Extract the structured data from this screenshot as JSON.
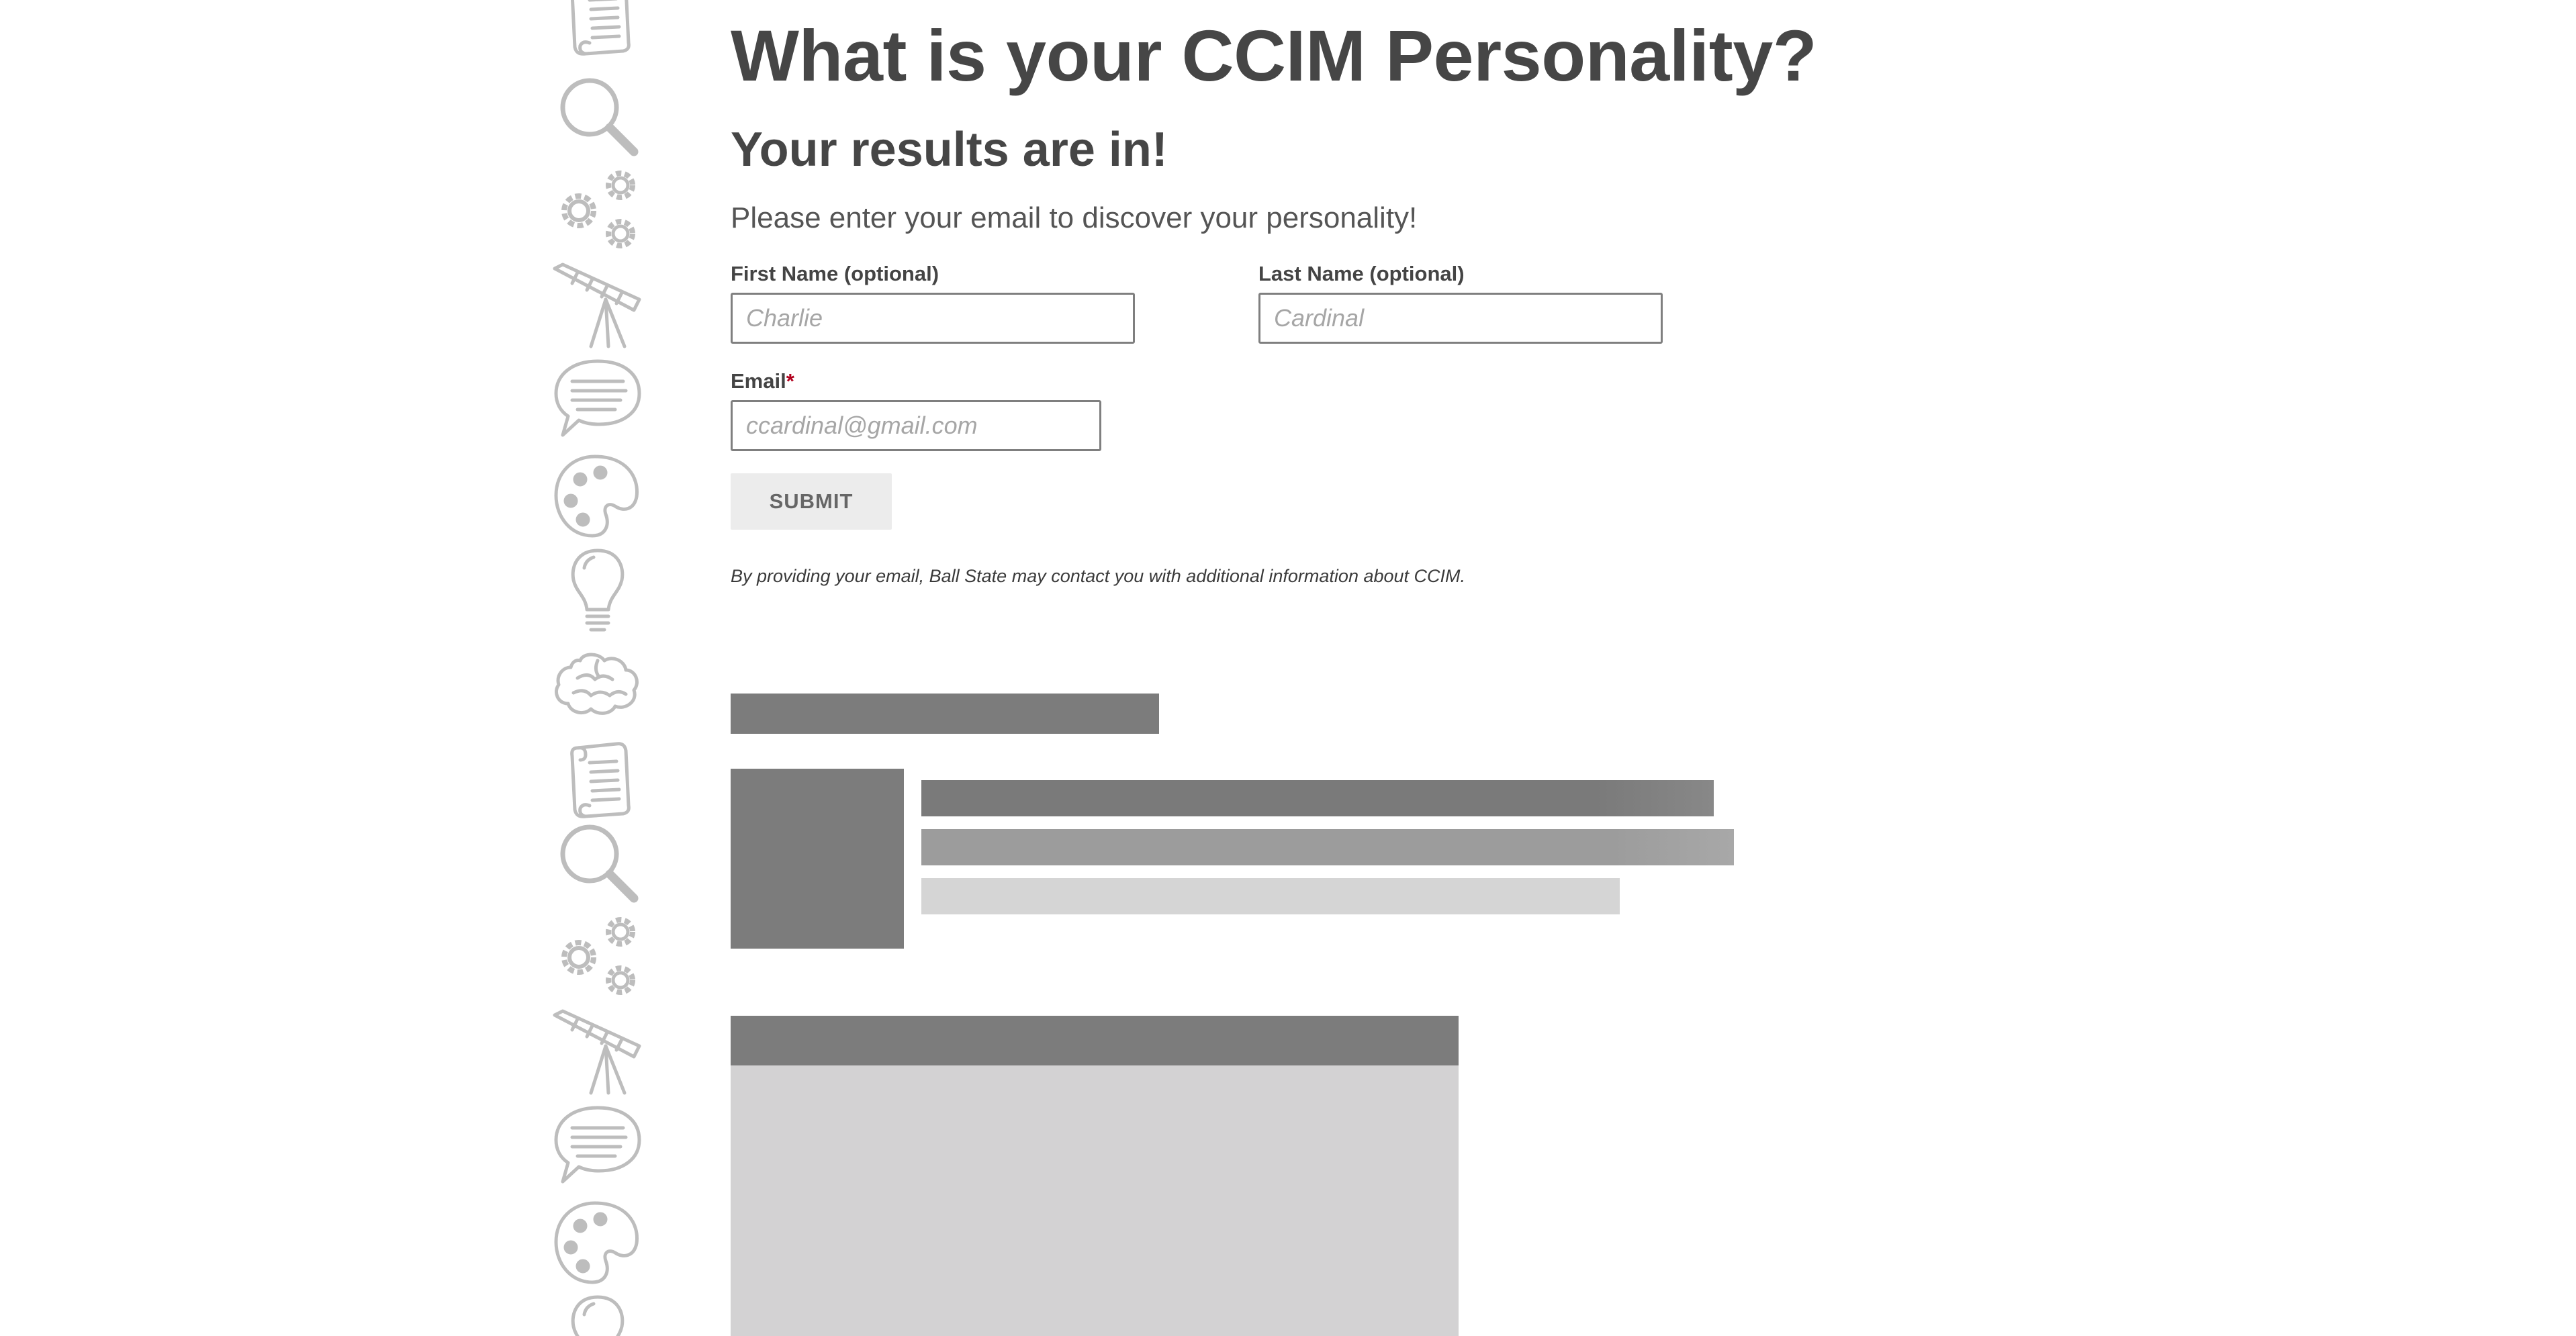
{
  "page": {
    "title": "What is your CCIM Personality?",
    "subtitle": "Your results are in!",
    "intro": "Please enter your email to discover your personality!"
  },
  "form": {
    "first_name": {
      "label": "First Name (optional)",
      "placeholder": "Charlie"
    },
    "last_name": {
      "label": "Last Name (optional)",
      "placeholder": "Cardinal"
    },
    "email": {
      "label": "Email",
      "required_mark": "*",
      "placeholder": "ccardinal@gmail.com"
    },
    "submit_label": "SUBMIT",
    "disclaimer": "By providing your email, Ball State may contact you with additional information about CCIM."
  },
  "decor": {
    "icon_color": "#bdbdbd",
    "icons": [
      "scroll-icon",
      "magnifier-icon",
      "gears-icon",
      "telescope-icon",
      "speech-bubble-icon",
      "palette-icon",
      "lightbulb-icon",
      "brain-icon",
      "scroll-icon",
      "magnifier-icon",
      "gears-icon",
      "telescope-icon",
      "speech-bubble-icon",
      "palette-icon",
      "lightbulb-icon"
    ]
  },
  "colors": {
    "heading": "#464646",
    "required": "#b1001d",
    "skeleton_dark": "#7c7c7c",
    "skeleton_light": "#d5d5d5"
  }
}
